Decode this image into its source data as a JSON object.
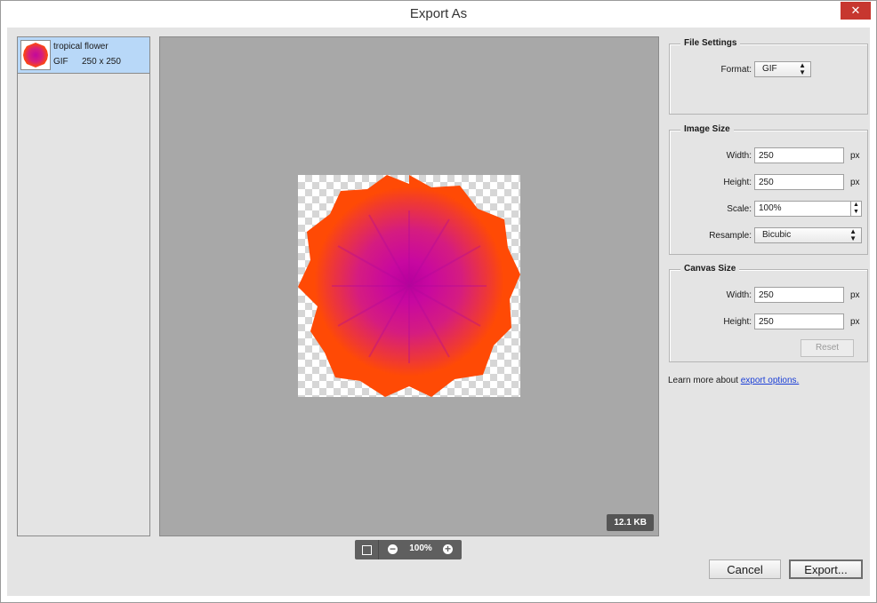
{
  "window": {
    "title": "Export As",
    "close_glyph": "✕"
  },
  "file_list": {
    "items": [
      {
        "name": "tropical flower",
        "format": "GIF",
        "dims": "250 x 250",
        "thumb_icon": "flower-thumbnail"
      }
    ]
  },
  "preview": {
    "file_size": "12.1 KB",
    "zoom": "100%",
    "image_icon": "flower-image"
  },
  "file_settings": {
    "title": "File Settings",
    "format_label": "Format:",
    "format_value": "GIF"
  },
  "image_size": {
    "title": "Image Size",
    "width_label": "Width:",
    "width_value": "250",
    "height_label": "Height:",
    "height_value": "250",
    "unit": "px",
    "scale_label": "Scale:",
    "scale_value": "100%",
    "resample_label": "Resample:",
    "resample_value": "Bicubic"
  },
  "canvas_size": {
    "title": "Canvas Size",
    "width_label": "Width:",
    "width_value": "250",
    "height_label": "Height:",
    "height_value": "250",
    "unit": "px",
    "reset_label": "Reset"
  },
  "learn": {
    "text": "Learn more about ",
    "link": "export options."
  },
  "buttons": {
    "cancel": "Cancel",
    "export": "Export..."
  },
  "colors": {
    "petal_outer": "#ff4a05",
    "petal_center": "#c2089c",
    "selection": "#b8d8f8",
    "panel": "#e4e4e4",
    "preview_bg": "#a8a8a8"
  }
}
